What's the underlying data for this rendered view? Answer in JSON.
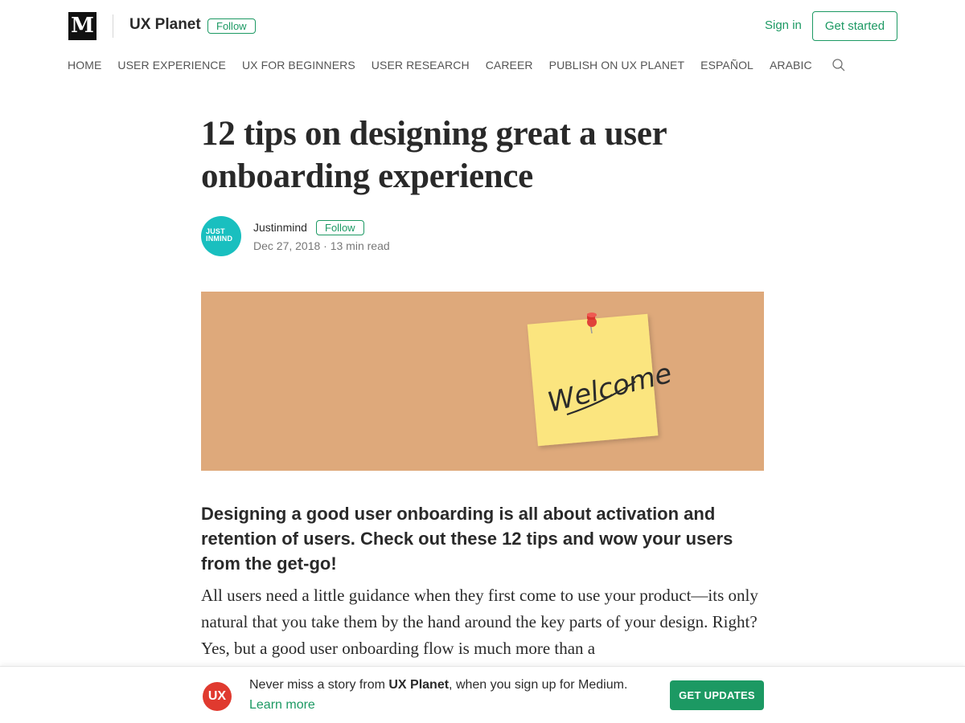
{
  "header": {
    "logo_letter": "M",
    "publication": "UX Planet",
    "follow_label": "Follow",
    "sign_in": "Sign in",
    "get_started": "Get started"
  },
  "nav": {
    "items": [
      "HOME",
      "USER EXPERIENCE",
      "UX FOR BEGINNERS",
      "USER RESEARCH",
      "CAREER",
      "PUBLISH ON UX PLANET",
      "ESPAÑOL",
      "ARABIC"
    ]
  },
  "article": {
    "title": "12 tips on designing great a user onboarding experience",
    "author": {
      "name": "Justinmind",
      "follow_label": "Follow",
      "avatar_line1": "JUST",
      "avatar_line2": "INMIND"
    },
    "meta": "Dec 27, 2018 · 13 min read",
    "hero_note_text": "Welcome",
    "subtitle": "Designing a good user onboarding is all about activation and retention of users. Check out these 12 tips and wow your users from the get-go!",
    "body": "All users need a little guidance when they first come to use your product—its only natural that you take them by the hand around the key parts of your design. Right? Yes, but a good user onboarding flow is much more than a"
  },
  "banner": {
    "logo_text": "UX",
    "msg_prefix": "Never miss a story from ",
    "msg_pub": "UX Planet",
    "msg_suffix": ", when you sign up for Medium.",
    "learn_more": "Learn more",
    "cta": "GET UPDATES"
  },
  "colors": {
    "accent": "#1c9963",
    "hero_bg": "#dea97b",
    "avatar_bg": "#19bfbf",
    "ux_logo": "#e03a2f",
    "sticky_note": "#fbe57f"
  },
  "icons": {
    "search": "search-icon",
    "pin": "pushpin-icon"
  }
}
